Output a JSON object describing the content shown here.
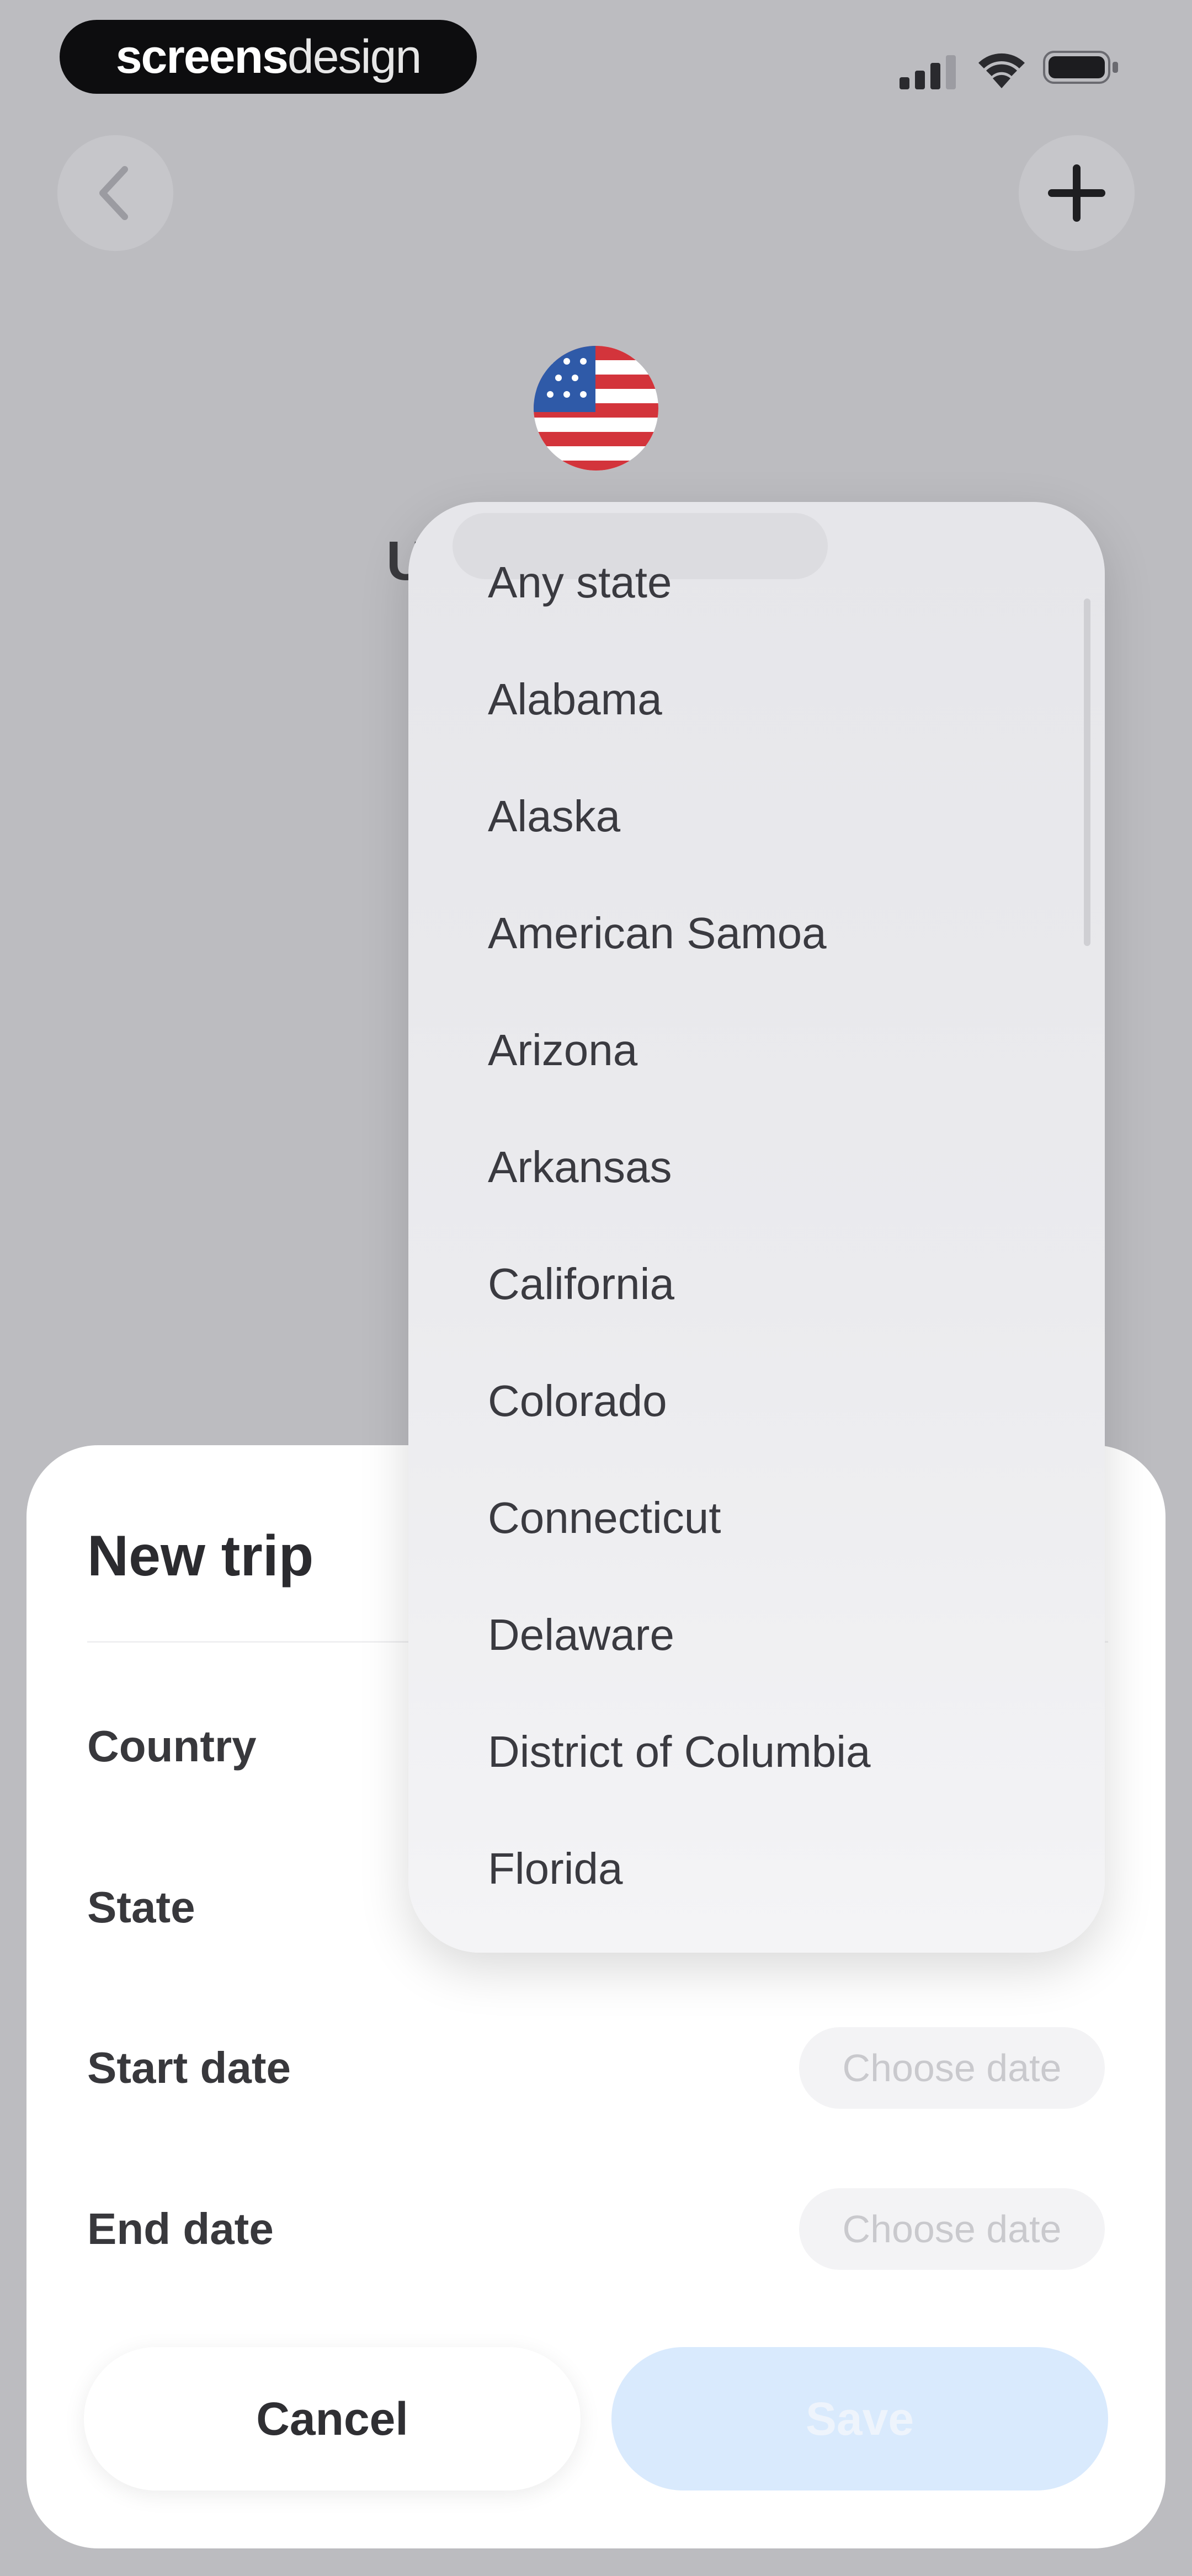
{
  "status_bar": {
    "brand_bold": "screens",
    "brand_light": "design"
  },
  "header": {
    "back_icon": "chevron-left-icon",
    "add_icon": "plus-icon",
    "flag_icon": "us-flag-icon",
    "title_initial": "U"
  },
  "sheet": {
    "title": "New trip",
    "rows": [
      {
        "label": "Country"
      },
      {
        "label": "State"
      },
      {
        "label": "Start date",
        "placeholder": "Choose date"
      },
      {
        "label": "End date",
        "placeholder": "Choose date"
      }
    ],
    "cancel_label": "Cancel",
    "save_label": "Save"
  },
  "dropdown": {
    "items": [
      "Any state",
      "Alabama",
      "Alaska",
      "American Samoa",
      "Arizona",
      "Arkansas",
      "California",
      "Colorado",
      "Connecticut",
      "Delaware",
      "District of Columbia",
      "Florida"
    ]
  },
  "colors": {
    "background": "#bcbcc0",
    "save_disabled": "#d9eafd",
    "flag_red": "#d3343b",
    "flag_blue": "#2f5aa8"
  }
}
